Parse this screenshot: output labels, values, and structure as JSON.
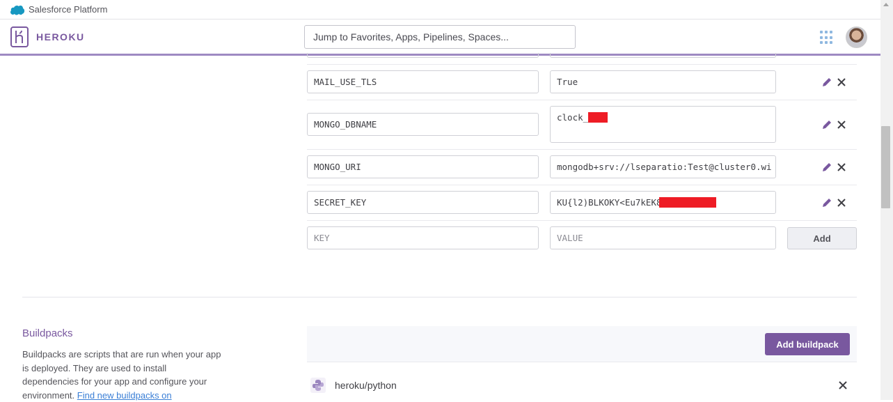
{
  "platform_bar": {
    "title": "Salesforce Platform"
  },
  "header": {
    "brand": "HEROKU",
    "search_placeholder": "Jump to Favorites, Apps, Pipelines, Spaces..."
  },
  "config_vars": [
    {
      "key": "MAIL_USE_TLS",
      "value": "True",
      "redacted": false
    },
    {
      "key": "MONGO_DBNAME",
      "value": "clock_",
      "redacted": true
    },
    {
      "key": "MONGO_URI",
      "value": "mongodb+srv://lseparatio:Test@cluster0.wi",
      "redacted": false
    },
    {
      "key": "SECRET_KEY",
      "value": "KU{l2)BLKOKY<Eu7kEK8",
      "redacted": true
    }
  ],
  "new_var": {
    "key_placeholder": "KEY",
    "value_placeholder": "VALUE",
    "add_label": "Add"
  },
  "buildpacks": {
    "title": "Buildpacks",
    "description": "Buildpacks are scripts that are run when your app is deployed. They are used to install dependencies for your app and configure your environment.",
    "link_text": "Find new buildpacks on",
    "add_label": "Add buildpack",
    "items": [
      {
        "name": "heroku/python"
      }
    ]
  },
  "colors": {
    "brand": "#79589f",
    "redaction": "#ee1c25",
    "accent_line": "#9e8ac2"
  }
}
